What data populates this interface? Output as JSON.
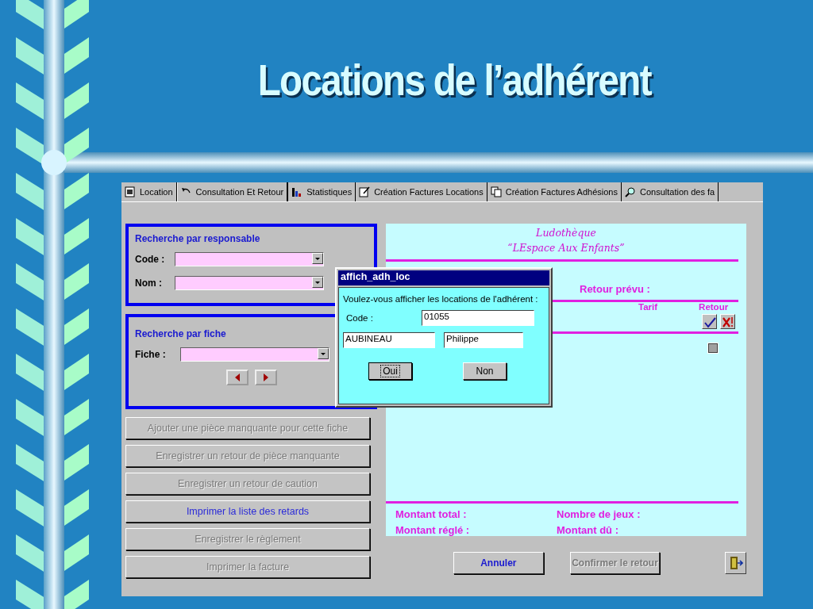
{
  "slide": {
    "title": "Locations de l’adhérent"
  },
  "tabs": [
    {
      "label": "Location",
      "selected": false
    },
    {
      "label": "Consultation Et Retour",
      "selected": true
    },
    {
      "label": "Statistiques",
      "selected": false
    },
    {
      "label": "Création Factures Locations",
      "selected": false
    },
    {
      "label": "Création  Factures Adhésions",
      "selected": false
    },
    {
      "label": "Consultation des fa",
      "selected": false
    }
  ],
  "search_by_responsible": {
    "title": "Recherche par responsable",
    "fields": [
      {
        "label": "Code :"
      },
      {
        "label": "Nom :"
      }
    ]
  },
  "search_by_record": {
    "title": "Recherche par fiche",
    "field": {
      "label": "Fiche :"
    }
  },
  "actions": [
    {
      "label": "Ajouter une pièce manquante pour cette fiche",
      "disabled": true
    },
    {
      "label": "Enregistrer un retour de pièce manquante",
      "disabled": true
    },
    {
      "label": "Enregistrer un retour de caution",
      "disabled": true
    },
    {
      "label": "Imprimer la liste des retards",
      "disabled": false
    },
    {
      "label": "Enregistrer le règlement",
      "disabled": true
    },
    {
      "label": "Imprimer la facture",
      "disabled": true
    }
  ],
  "summary_panel": {
    "header_lines": [
      "Ludothèque",
      "“LEspace Aux Enfants”"
    ],
    "return_label": "Retour prévu :",
    "columns": [
      "Tarif",
      "Retour"
    ],
    "totals": [
      [
        "Montant total :",
        "Nombre de jeux :"
      ],
      [
        "Montant réglé :",
        "Montant dû :"
      ]
    ]
  },
  "footer_buttons": [
    {
      "label": "Annuler",
      "disabled": false
    },
    {
      "label": "Confirmer le retour",
      "disabled": true
    }
  ],
  "dialog": {
    "title": "affich_adh_loc",
    "prompt": "Voulez-vous afficher les locations de l'adhérent :",
    "code_label": "Code :",
    "code": "01055",
    "last_name": "AUBINEAU",
    "first_name": "Philippe",
    "buttons": [
      {
        "label": "Oui",
        "focused": true
      },
      {
        "label": "Non",
        "focused": false
      }
    ]
  }
}
